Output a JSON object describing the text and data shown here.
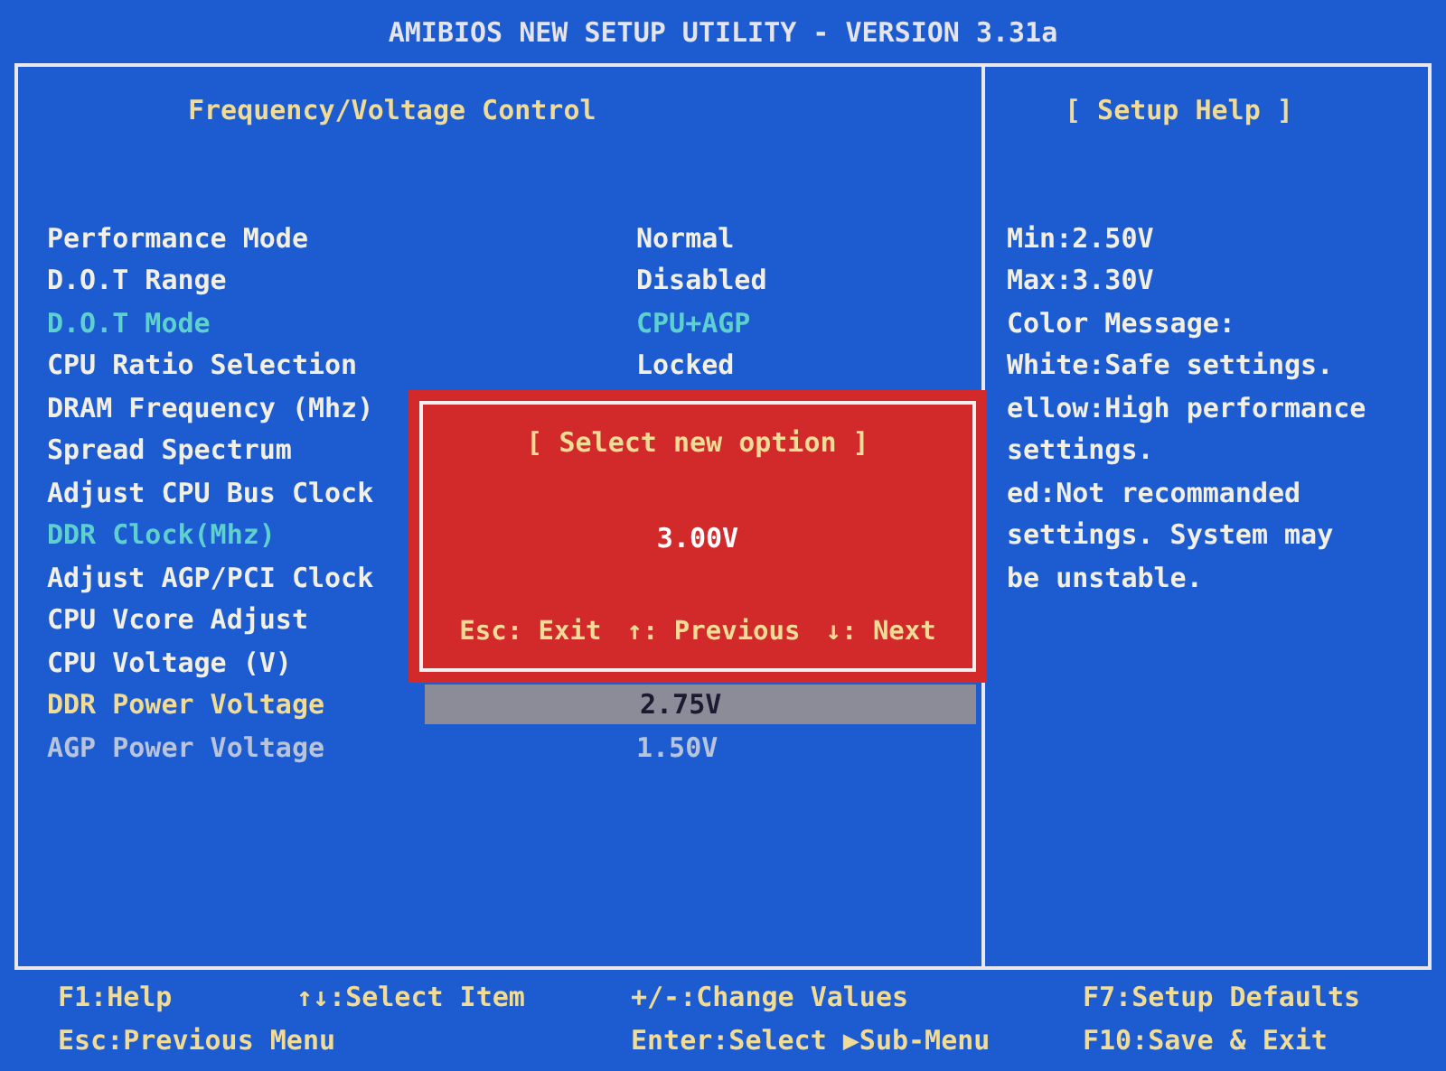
{
  "title": "AMIBIOS NEW SETUP UTILITY - VERSION 3.31a",
  "panel": {
    "title": "Frequency/Voltage Control",
    "items": [
      {
        "label": "Performance Mode",
        "value": "Normal",
        "color": "#f2f0e4",
        "selected": false
      },
      {
        "label": "D.O.T Range",
        "value": "Disabled",
        "color": "#f2f0e4",
        "selected": false
      },
      {
        "label": "D.O.T Mode",
        "value": "CPU+AGP",
        "color": "#5fd0d0",
        "selected": false
      },
      {
        "label": "CPU Ratio Selection",
        "value": "Locked",
        "color": "#f2f0e4",
        "selected": false
      },
      {
        "label": "DRAM Frequency (Mhz)",
        "color": "#f2f0e4",
        "selected": false
      },
      {
        "label": "Spread Spectrum",
        "color": "#f2f0e4",
        "selected": false
      },
      {
        "label": "Adjust CPU Bus Clock",
        "color": "#f2f0e4",
        "selected": false
      },
      {
        "label": "DDR Clock(Mhz)",
        "color": "#5fd0d0",
        "selected": false
      },
      {
        "label": "Adjust AGP/PCI Clock",
        "color": "#f2f0e4",
        "selected": false
      },
      {
        "label": "CPU Vcore Adjust",
        "color": "#f2f0e4",
        "selected": false
      },
      {
        "label": "CPU Voltage (V)",
        "color": "#f2f0e4",
        "selected": false
      },
      {
        "label": "DDR Power Voltage",
        "value": "2.75V",
        "color": "#f0dc96",
        "selected": true
      },
      {
        "label": "AGP Power Voltage",
        "value": "1.50V",
        "color": "#b8c4dc",
        "selected": false
      }
    ]
  },
  "help": {
    "title": "[  Setup Help  ]",
    "lines": [
      "Min:2.50V",
      "Max:3.30V",
      "Color Message:",
      "White:Safe settings.",
      "ellow:High performance",
      "settings.",
      "ed:Not recommanded",
      "settings. System may",
      "be unstable."
    ]
  },
  "dialog": {
    "title": "[ Select new option ]",
    "value": "3.00V",
    "keys": [
      "Esc: Exit",
      "↑: Previous",
      "↓: Next"
    ]
  },
  "footer": {
    "keys": [
      "F1:Help",
      "↑↓:Select Item",
      "+/-:Change Values",
      "F7:Setup Defaults",
      "Esc:Previous Menu",
      "Enter:Select ▶Sub-Menu",
      "F10:Save & Exit"
    ]
  }
}
